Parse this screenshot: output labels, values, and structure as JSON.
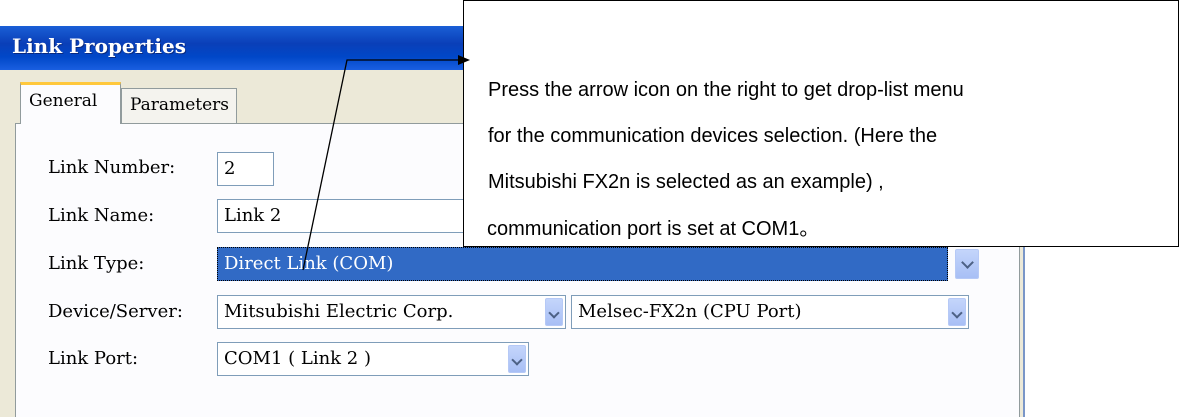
{
  "dialog": {
    "title": "Link Properties",
    "tabs": [
      {
        "label": "General",
        "active": true
      },
      {
        "label": "Parameters",
        "active": false
      }
    ],
    "fields": {
      "link_number": {
        "label": "Link Number:",
        "value": "2"
      },
      "link_name": {
        "label": "Link Name:",
        "value": "Link 2"
      },
      "link_type": {
        "label": "Link Type:",
        "value": "Direct Link (COM)"
      },
      "device_server": {
        "label": "Device/Server:",
        "manufacturer": "Mitsubishi Electric Corp.",
        "model": "Melsec-FX2n (CPU Port)"
      },
      "link_port": {
        "label": "Link Port:",
        "value": "COM1 ( Link 2 )"
      }
    }
  },
  "callout": {
    "lines": [
      "Press the arrow icon on the right to get drop-list menu",
      "for the communication devices selection. (Here the",
      "Mitsubishi FX2n is selected as an example) ,",
      "communication port is set at COM1。"
    ]
  },
  "colors": {
    "titlebar": "#0a3fb8",
    "selection": "#316ac5",
    "tab_highlight": "#ffc83c"
  }
}
